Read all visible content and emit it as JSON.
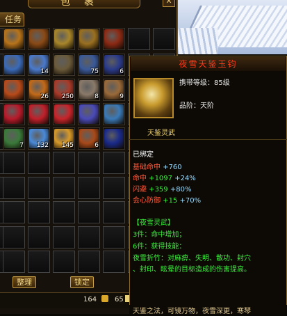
{
  "bag": {
    "title": "包裹",
    "close": "✕",
    "tab_task": "任务",
    "button_sort": "整理",
    "button_lock": "锁定",
    "gold": "164",
    "silver": "65"
  },
  "items": [
    {
      "row": 0,
      "col": 0,
      "color": "#b8741a",
      "count": ""
    },
    {
      "row": 0,
      "col": 1,
      "color": "#8a4a16",
      "count": ""
    },
    {
      "row": 0,
      "col": 2,
      "color": "#a8862a",
      "count": ""
    },
    {
      "row": 0,
      "col": 3,
      "color": "#9a7020",
      "count": ""
    },
    {
      "row": 0,
      "col": 4,
      "color": "#8c2a14",
      "count": ""
    },
    {
      "row": 1,
      "col": 0,
      "color": "#3a6ab8",
      "count": ""
    },
    {
      "row": 1,
      "col": 1,
      "color": "#4a7acc",
      "count": "14"
    },
    {
      "row": 1,
      "col": 2,
      "color": "#6a5a3a",
      "count": ""
    },
    {
      "row": 1,
      "col": 3,
      "color": "#3a5a9a",
      "count": "75"
    },
    {
      "row": 1,
      "col": 4,
      "color": "#2a3a8a",
      "count": "6"
    },
    {
      "row": 2,
      "col": 0,
      "color": "#b84a1a",
      "count": ""
    },
    {
      "row": 2,
      "col": 1,
      "color": "#c26a1a",
      "count": "26"
    },
    {
      "row": 2,
      "col": 2,
      "color": "#a83a2a",
      "count": "250"
    },
    {
      "row": 2,
      "col": 3,
      "color": "#8a7a6a",
      "count": "8"
    },
    {
      "row": 2,
      "col": 4,
      "color": "#9a6a3a",
      "count": "9"
    },
    {
      "row": 3,
      "col": 0,
      "color": "#b81a2a",
      "count": ""
    },
    {
      "row": 3,
      "col": 1,
      "color": "#c0202a",
      "count": ""
    },
    {
      "row": 3,
      "col": 2,
      "color": "#c8242a",
      "count": ""
    },
    {
      "row": 3,
      "col": 3,
      "color": "#4a4ab8",
      "count": ""
    },
    {
      "row": 3,
      "col": 4,
      "color": "#3a7ab8",
      "count": ""
    },
    {
      "row": 4,
      "col": 0,
      "color": "#3a7a3a",
      "count": "7"
    },
    {
      "row": 4,
      "col": 1,
      "color": "#4a8ad8",
      "count": "132"
    },
    {
      "row": 4,
      "col": 2,
      "color": "#d89a2a",
      "count": "145"
    },
    {
      "row": 4,
      "col": 3,
      "color": "#a84a1a",
      "count": "6"
    },
    {
      "row": 4,
      "col": 4,
      "color": "#1a2a8a",
      "count": ""
    }
  ],
  "tooltip": {
    "name": "夜雪天鉴玉钧",
    "carry_level": "携带等级：85级",
    "grade": "品阶：天阶",
    "subtitle": "天鉴灵武",
    "bound": "已绑定",
    "stats": [
      {
        "label": "基础命中",
        "value": "+760",
        "bonus": ""
      },
      {
        "label": "命中",
        "value": "+1097",
        "bonus": "+24%"
      },
      {
        "label": "闪避",
        "value": "+359",
        "bonus": "+80%"
      },
      {
        "label": "会心防御",
        "value": "+15",
        "bonus": "+70%"
      }
    ],
    "set_name": "【夜雪灵武】",
    "set_3": "3件：命中增加；",
    "set_6": "6件：获得技能：",
    "skill_line1": "夜雪折竹：对麻痹、失明、散功、封穴",
    "skill_line2": "、封印、眩晕的目标造成的伤害提高。",
    "flavor": "天鉴之法，可镜万物，夜雪深更，寒琴"
  },
  "colors": {
    "title_red": "#ff3a1a",
    "stat_green": "#3af03a",
    "stat_red": "#ff5a3a",
    "set_green": "#3af03a",
    "bonus_blue": "#9adcff"
  }
}
